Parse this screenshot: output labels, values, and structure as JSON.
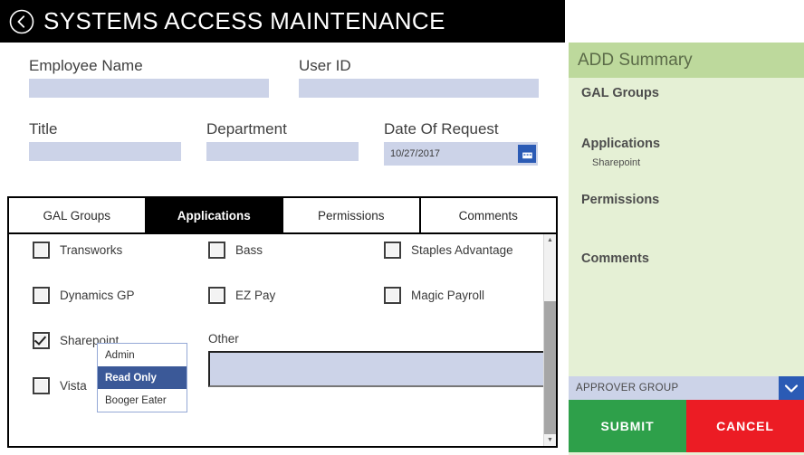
{
  "header": {
    "title": "SYSTEMS ACCESS MAINTENANCE",
    "back_icon": "chevron-left-circle-icon"
  },
  "form": {
    "fields": [
      {
        "label": "Employee Name",
        "value": "",
        "placeholder": ""
      },
      {
        "label": "User ID",
        "value": "",
        "placeholder": ""
      },
      {
        "label": "Title",
        "value": "",
        "placeholder": ""
      },
      {
        "label": "Department",
        "value": "",
        "placeholder": ""
      },
      {
        "label": "Date Of Request",
        "value": "10/27/2017",
        "placeholder": ""
      }
    ],
    "date_picker_icon": "calendar-icon"
  },
  "tabs": [
    {
      "label": "GAL Groups",
      "active": false
    },
    {
      "label": "Applications",
      "active": true
    },
    {
      "label": "Permissions",
      "active": false
    },
    {
      "label": "Comments",
      "active": false
    }
  ],
  "applications": {
    "rows": [
      [
        {
          "label": "Transworks",
          "checked": false
        },
        {
          "label": "Bass",
          "checked": false
        },
        {
          "label": "Staples Advantage",
          "checked": false
        }
      ],
      [
        {
          "label": "Dynamics GP",
          "checked": false
        },
        {
          "label": "EZ Pay",
          "checked": false
        },
        {
          "label": "Magic Payroll",
          "checked": false
        }
      ],
      [
        {
          "label": "Sharepoint",
          "checked": true
        }
      ],
      [
        {
          "label": "Vista",
          "checked": false
        }
      ]
    ],
    "other_label": "Other",
    "other_value": ""
  },
  "permission_dropdown": {
    "options": [
      {
        "label": "Admin",
        "selected": false
      },
      {
        "label": "Read Only",
        "selected": true
      },
      {
        "label": "Booger Eater",
        "selected": false
      }
    ]
  },
  "scrollbar": {
    "up_icon": "caret-up-icon",
    "down_icon": "caret-down-icon"
  },
  "summary": {
    "header": "ADD Summary",
    "sections": [
      {
        "title": "GAL Groups",
        "items": []
      },
      {
        "title": "Applications",
        "items": [
          "Sharepoint"
        ]
      },
      {
        "title": "Permissions",
        "items": []
      },
      {
        "title": "Comments",
        "items": []
      }
    ]
  },
  "approver": {
    "label": "APPROVER GROUP",
    "caret_icon": "chevron-down-icon"
  },
  "actions": {
    "submit_label": "SUBMIT",
    "cancel_label": "CANCEL"
  },
  "colors": {
    "header_bg": "#000000",
    "input_bg": "#ccd3e8",
    "accent_blue": "#2b5bb5",
    "summary_header_bg": "#bdd99c",
    "summary_bg": "#e5f0d5",
    "submit_green": "#2ea04a",
    "cancel_red": "#ec1c24",
    "dropdown_selected": "#3b5998"
  }
}
